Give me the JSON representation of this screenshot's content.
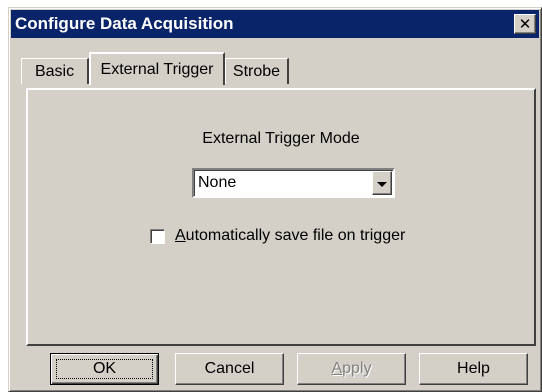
{
  "window": {
    "title": "Configure Data Acquisition",
    "close_symbol": "✕"
  },
  "tabs": [
    {
      "label": "Basic",
      "active": false
    },
    {
      "label": "External Trigger",
      "active": true
    },
    {
      "label": "Strobe",
      "active": false
    }
  ],
  "trigger": {
    "mode_label": "External Trigger Mode",
    "mode_value": "None",
    "autosave_checked": false,
    "autosave_mnemonic": "A",
    "autosave_label_rest": "utomatically save file on trigger"
  },
  "buttons": {
    "ok": "OK",
    "cancel": "Cancel",
    "apply_mnemonic": "A",
    "apply_rest": "pply",
    "help": "Help"
  },
  "colors": {
    "face": "#d4d0c8",
    "titlebar": "#0a246a",
    "disabled_text": "#808080"
  }
}
